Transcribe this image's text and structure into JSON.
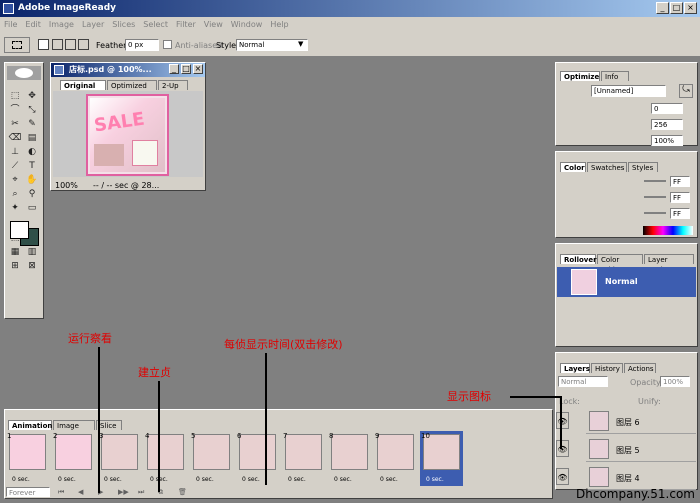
{
  "window": {
    "title": "Adobe ImageReady"
  },
  "menu": [
    "File",
    "Edit",
    "Image",
    "Layer",
    "Slices",
    "Select",
    "Filter",
    "View",
    "Window",
    "Help"
  ],
  "options": {
    "feather_label": "Feather:",
    "feather_value": "0 px",
    "anti_alias": "Anti-aliased",
    "style_label": "Style:",
    "style_value": "Normal"
  },
  "doc": {
    "title": "店标.psd @ 100%...",
    "tabs": [
      "Original",
      "Optimized",
      "2-Up"
    ],
    "zoom": "100%",
    "status": "-- / -- sec @ 28...",
    "thumb_text": "SALE"
  },
  "optimize": {
    "tabs": [
      "Optimize",
      "Info"
    ],
    "preset": "[Unnamed]",
    "field1": "0",
    "field2": "256",
    "field3": "100%"
  },
  "color": {
    "tabs": [
      "Color",
      "Swatches",
      "Styles"
    ],
    "vals": [
      "FF",
      "FF",
      "FF"
    ]
  },
  "rollovers": {
    "tabs": [
      "Rollovers",
      "Color Table",
      "Layer Options"
    ],
    "state": "Normal"
  },
  "layers": {
    "tabs": [
      "Layers",
      "History",
      "Actions"
    ],
    "blend": "Normal",
    "opacity_label": "Opacity:",
    "opacity": "100%",
    "lock": "Lock:",
    "unify": "Unify:",
    "items": [
      "图层 6",
      "图层 5",
      "图层 4"
    ]
  },
  "animation": {
    "tabs": [
      "Animation",
      "Image Map",
      "Slice"
    ],
    "loop": "Forever",
    "frames": [
      {
        "n": "1",
        "d": "0 sec."
      },
      {
        "n": "2",
        "d": "0 sec."
      },
      {
        "n": "3",
        "d": "0 sec."
      },
      {
        "n": "4",
        "d": "0 sec."
      },
      {
        "n": "5",
        "d": "0 sec."
      },
      {
        "n": "6",
        "d": "0 sec."
      },
      {
        "n": "7",
        "d": "0 sec."
      },
      {
        "n": "8",
        "d": "0 sec."
      },
      {
        "n": "9",
        "d": "0 sec."
      },
      {
        "n": "10",
        "d": "0 sec."
      }
    ]
  },
  "annotations": {
    "run": "运行察看",
    "create": "建立贞",
    "time": "每侦显示时间(双击修改)",
    "show": "显示图标"
  },
  "watermark": "Dhcompany.51.com"
}
